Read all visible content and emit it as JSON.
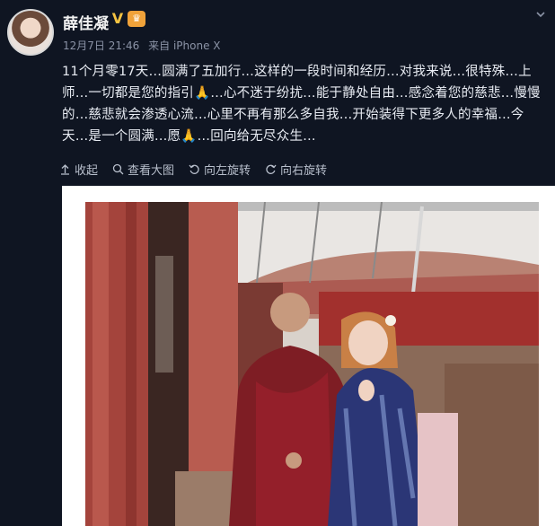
{
  "post": {
    "username": "薛佳凝",
    "verified_badge": "V",
    "member_icon": "crown-icon",
    "date": "12月7日 21:46",
    "source": "来自 iPhone X",
    "text_lines": [
      "11个月零17天…圆满了五加行…这样的一段时间和经历…对我来说…很特殊…上",
      "师…一切都是您的指引🙏…心不迷于纷扰…能于静处自由…感念着您的慈悲…慢慢",
      "的…慈悲就会渗透心流…心里不再有那么多自我…开始装得下更多人的幸福…今",
      "天…是一个圆满…愿🙏…回向给无尽众生…"
    ]
  },
  "actions": {
    "collapse": "收起",
    "view_large": "查看大图",
    "rotate_left": "向左旋转",
    "rotate_right": "向右旋转"
  },
  "colors": {
    "background": "#0f1522",
    "text": "#e8ecf3",
    "meta": "#8b93a6",
    "verified": "#f5c342"
  }
}
